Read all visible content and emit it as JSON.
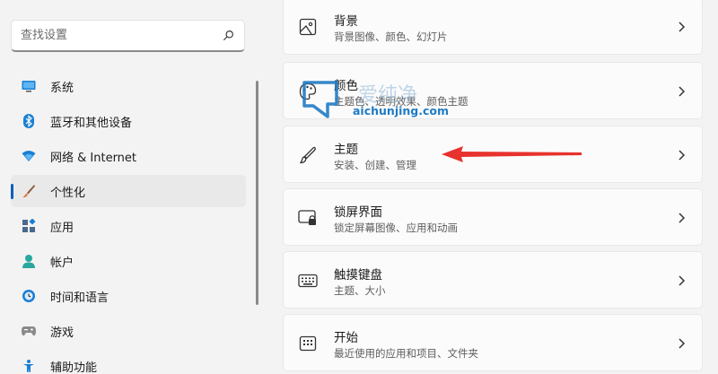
{
  "search": {
    "placeholder": "查找设置"
  },
  "nav": {
    "items": [
      {
        "label": "系统",
        "icon": "monitor-icon"
      },
      {
        "label": "蓝牙和其他设备",
        "icon": "bluetooth-icon"
      },
      {
        "label": "网络 & Internet",
        "icon": "wifi-icon"
      },
      {
        "label": "个性化",
        "icon": "brush-icon",
        "selected": true
      },
      {
        "label": "应用",
        "icon": "apps-icon"
      },
      {
        "label": "帐户",
        "icon": "account-icon"
      },
      {
        "label": "时间和语言",
        "icon": "globe-clock-icon"
      },
      {
        "label": "游戏",
        "icon": "gamepad-icon"
      },
      {
        "label": "辅助功能",
        "icon": "accessibility-icon"
      }
    ]
  },
  "cards": [
    {
      "title": "背景",
      "desc": "背景图像、颜色、幻灯片",
      "icon": "image-icon"
    },
    {
      "title": "颜色",
      "desc": "主题色、透明效果、颜色主题",
      "icon": "palette-icon"
    },
    {
      "title": "主题",
      "desc": "安装、创建、管理",
      "icon": "brush-icon"
    },
    {
      "title": "锁屏界面",
      "desc": "锁定屏幕图像、应用和动画",
      "icon": "lock-screen-icon"
    },
    {
      "title": "触摸键盘",
      "desc": "主题、大小",
      "icon": "keyboard-icon"
    },
    {
      "title": "开始",
      "desc": "最近使用的应用和项目、文件夹",
      "icon": "start-menu-icon"
    }
  ],
  "watermark": {
    "name": "爱纯净",
    "url": "aichunjing.com"
  },
  "colors": {
    "accent": "#005fb8",
    "annotation_arrow": "#e8322d",
    "watermark": "#1f7bc4"
  }
}
